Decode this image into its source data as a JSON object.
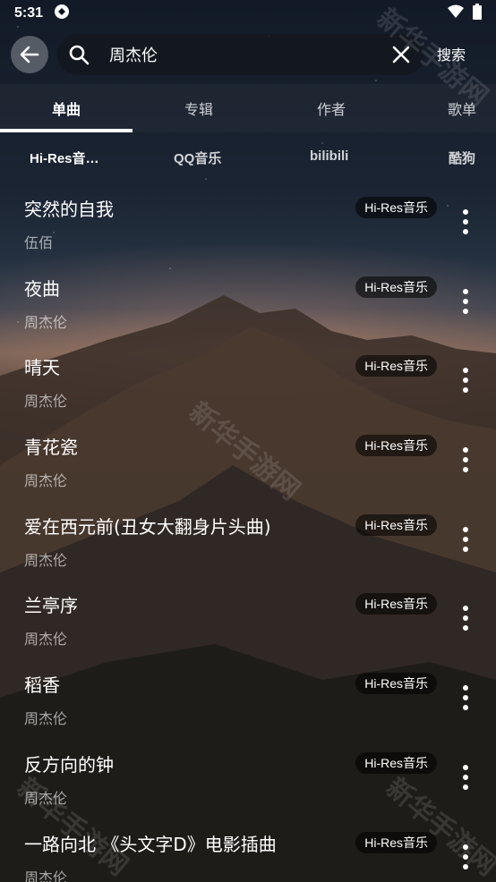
{
  "status_bar": {
    "time": "5:31"
  },
  "search": {
    "query": "周杰伦",
    "submit_label": "搜索"
  },
  "tabs": [
    {
      "label": "单曲"
    },
    {
      "label": "专辑"
    },
    {
      "label": "作者"
    },
    {
      "label": "歌单"
    }
  ],
  "sources": [
    {
      "label": "Hi-Res音…"
    },
    {
      "label": "QQ音乐"
    },
    {
      "label": "bilibili"
    },
    {
      "label": "酷狗"
    }
  ],
  "songs": [
    {
      "title": "突然的自我",
      "artist": "伍佰",
      "source": "Hi-Res音乐"
    },
    {
      "title": "夜曲",
      "artist": "周杰伦",
      "source": "Hi-Res音乐"
    },
    {
      "title": "晴天",
      "artist": "周杰伦",
      "source": "Hi-Res音乐"
    },
    {
      "title": "青花瓷",
      "artist": "周杰伦",
      "source": "Hi-Res音乐"
    },
    {
      "title": "爱在西元前(丑女大翻身片头曲)",
      "artist": "周杰伦",
      "source": "Hi-Res音乐"
    },
    {
      "title": "兰亭序",
      "artist": "周杰伦",
      "source": "Hi-Res音乐"
    },
    {
      "title": "稻香",
      "artist": "周杰伦",
      "source": "Hi-Res音乐"
    },
    {
      "title": "反方向的钟",
      "artist": "周杰伦",
      "source": "Hi-Res音乐"
    },
    {
      "title": "一路向北 《头文字D》电影插曲",
      "artist": "周杰伦",
      "source": "Hi-Res音乐"
    }
  ],
  "watermark": "新华手游网"
}
